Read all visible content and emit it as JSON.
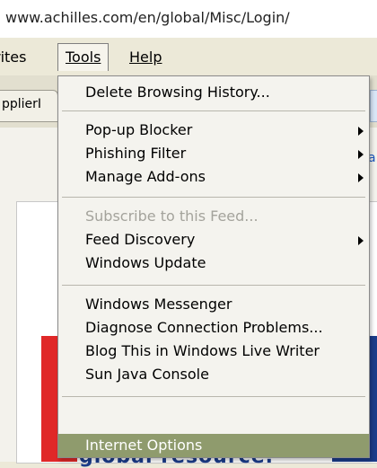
{
  "address_bar": {
    "url": "www.achilles.com/en/global/Misc/Login/"
  },
  "menubar": {
    "favorites_partial": "rites",
    "tools": "Tools",
    "help": "Help"
  },
  "page": {
    "tab_partial": "pplierI",
    "bottom_text": "global resource."
  },
  "tools_menu": {
    "items": [
      {
        "label": "Delete Browsing History...",
        "disabled": false,
        "submenu": false
      },
      {
        "label": "Pop-up Blocker",
        "disabled": false,
        "submenu": true
      },
      {
        "label": "Phishing Filter",
        "disabled": false,
        "submenu": true
      },
      {
        "label": "Manage Add-ons",
        "disabled": false,
        "submenu": true
      },
      {
        "label": "Subscribe to this Feed...",
        "disabled": true,
        "submenu": false
      },
      {
        "label": "Feed Discovery",
        "disabled": false,
        "submenu": true
      },
      {
        "label": "Windows Update",
        "disabled": false,
        "submenu": false
      },
      {
        "label": "Windows Messenger",
        "disabled": false,
        "submenu": false
      },
      {
        "label": "Diagnose Connection Problems...",
        "disabled": false,
        "submenu": false
      },
      {
        "label": "Blog This in Windows Live Writer",
        "disabled": false,
        "submenu": false
      },
      {
        "label": "Sun Java Console",
        "disabled": false,
        "submenu": false
      },
      {
        "label": "Internet Options",
        "disabled": false,
        "submenu": false,
        "highlighted": true
      }
    ]
  },
  "colors": {
    "highlight": "#8f9b6d",
    "brand_red": "#e02828",
    "brand_blue": "#1b3c8a"
  }
}
